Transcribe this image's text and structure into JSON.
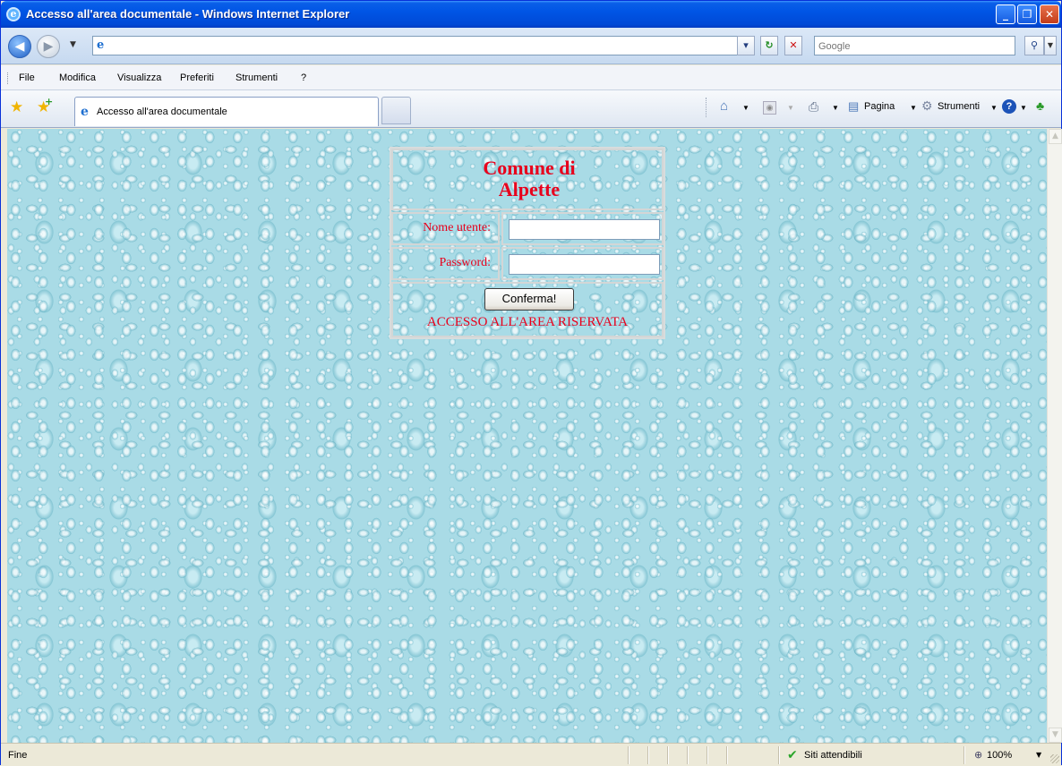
{
  "window": {
    "title": "Accesso all'area documentale - Windows Internet Explorer",
    "app_icon": "ie-logo-icon",
    "controls": {
      "minimize": "_",
      "maximize": "❐",
      "close": "✕"
    }
  },
  "address_bar": {
    "url": "",
    "page_icon": "ie-page-icon",
    "search_placeholder": "Google"
  },
  "menu": {
    "items": [
      "File",
      "Modifica",
      "Visualizza",
      "Preferiti",
      "Strumenti",
      "?"
    ]
  },
  "tabs": [
    {
      "label": "Accesso all'area documentale",
      "icon": "ie-page-icon",
      "active": true
    }
  ],
  "command_bar": {
    "page_label": "Pagina",
    "tools_label": "Strumenti",
    "icons": [
      "home-icon",
      "feeds-icon",
      "print-icon",
      "page-icon",
      "tools-icon",
      "help-icon",
      "research-icon"
    ]
  },
  "login": {
    "title_line1": "Comune di",
    "title_line2": "Alpette",
    "username_label": "Nome utente:",
    "username_value": "",
    "password_label": "Password:",
    "password_value": "",
    "submit_label": "Conferma!",
    "area_text": "ACCESSO ALL'AREA RISERVATA"
  },
  "status_bar": {
    "status": "Fine",
    "zone": "Siti attendibili",
    "zoom": "100%"
  },
  "colors": {
    "accent_red": "#e8001c",
    "page_background": "#a9dbe6",
    "titlebar_blue": "#0055e5"
  }
}
